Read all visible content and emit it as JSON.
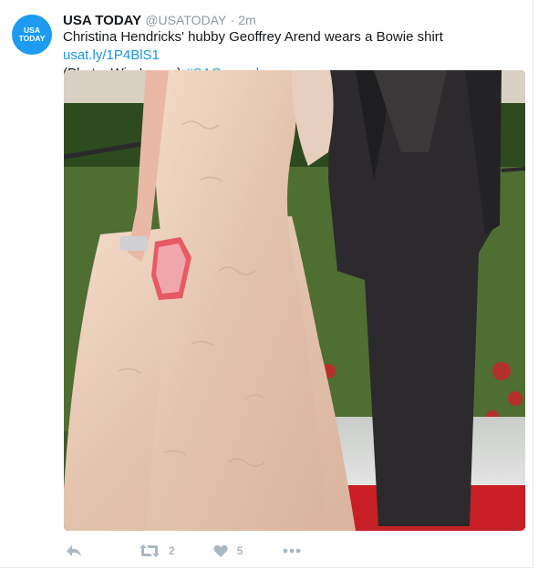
{
  "tweet": {
    "avatar_text": [
      "USA",
      "TODAY"
    ],
    "name": "USA TODAY",
    "handle": "@USATODAY",
    "separator": "·",
    "time": "2m",
    "text": "Christina Hendricks' hubby Geoffrey Arend wears a Bowie shirt ",
    "link": "usat.ly/1P4BlS1",
    "text2": "(Photo: WireImage) ",
    "hashtag": "#SAGawards"
  },
  "actions": {
    "retweet_count": "2",
    "like_count": "5"
  },
  "colors": {
    "link": "#1b95e0",
    "avatar": "#1d9bf0",
    "muted": "#aab8c2"
  }
}
